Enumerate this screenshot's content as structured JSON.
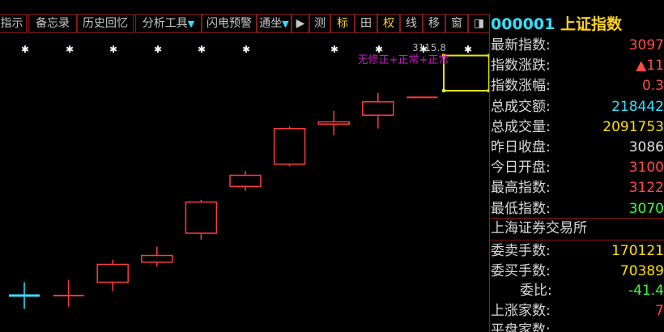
{
  "toolbar": {
    "items": [
      {
        "label": "指示"
      },
      {
        "label": "备忘录"
      },
      {
        "label": "历史回忆"
      },
      {
        "label": "分析工具",
        "arrow": "▼"
      },
      {
        "label": "闪电预警"
      },
      {
        "label": "通坐",
        "arrow": "▼"
      },
      {
        "label": "▶"
      },
      {
        "label": "测"
      },
      {
        "label": "标"
      },
      {
        "label": "田"
      },
      {
        "label": "权"
      },
      {
        "label": "线"
      },
      {
        "label": "移"
      },
      {
        "label": "窗"
      },
      {
        "label": "◨"
      }
    ]
  },
  "chart": {
    "price_label": "3115.8",
    "rights_mode": "无修正+正常+正常",
    "colors": {
      "up": "#ff3b3b",
      "doji": "#33e0ff",
      "box": "#e6e600",
      "marker": "#ffffff",
      "mode_text": "#c020c0"
    }
  },
  "chart_data": {
    "type": "candlestick",
    "series": [
      {
        "open": 3008,
        "close": 3008,
        "high": 3014,
        "low": 3002
      },
      {
        "open": 3008,
        "close": 3008,
        "high": 3015,
        "low": 3003
      },
      {
        "open": 3014,
        "close": 3022,
        "high": 3024,
        "low": 3010
      },
      {
        "open": 3023,
        "close": 3026,
        "high": 3030,
        "low": 3021
      },
      {
        "open": 3036,
        "close": 3050,
        "high": 3051,
        "low": 3033
      },
      {
        "open": 3057,
        "close": 3062,
        "high": 3064,
        "low": 3055
      },
      {
        "open": 3067,
        "close": 3083,
        "high": 3084,
        "low": 3066
      },
      {
        "open": 3085,
        "close": 3086,
        "high": 3091,
        "low": 3080
      },
      {
        "open": 3089,
        "close": 3095,
        "high": 3099,
        "low": 3083
      },
      {
        "open": 3097,
        "close": 3097,
        "high": 3097,
        "low": 3097
      },
      {
        "open": 3100,
        "close": 3115.8,
        "high": 3115.8,
        "low": 3096
      }
    ]
  },
  "panel": {
    "code": "000001",
    "name": "上证指数",
    "rows": [
      {
        "label": "最新指数:",
        "value": "3097",
        "color": "#ff4a4a"
      },
      {
        "label": "指数涨跌:",
        "value": "▲11",
        "color": "#ff4a4a"
      },
      {
        "label": "指数涨幅:",
        "value": "0.3",
        "color": "#ff4a4a"
      },
      {
        "label": "总成交额:",
        "value": "218442",
        "color": "#33e0ff"
      },
      {
        "label": "总成交量:",
        "value": "2091753",
        "color": "#ffe000"
      },
      {
        "label": "昨日收盘:",
        "value": "3086",
        "color": "#e0e0e0"
      },
      {
        "label": "今日开盘:",
        "value": "3100",
        "color": "#ff4a4a"
      },
      {
        "label": "最高指数:",
        "value": "3122",
        "color": "#ff4a4a"
      },
      {
        "label": "最低指数:",
        "value": "3070",
        "color": "#3cff3c"
      }
    ],
    "exchange": "上海证券交易所",
    "rows2": [
      {
        "label": "委卖手数:",
        "value": "170121",
        "color": "#ffe000",
        "ratio": false
      },
      {
        "label": "委买手数:",
        "value": "70389",
        "color": "#ffe000",
        "ratio": false
      },
      {
        "label": "委比:",
        "value": "-41.4",
        "color": "#3cff3c",
        "ratio": true
      },
      {
        "label": "上涨家数:",
        "value": "7",
        "color": "#ff4a4a",
        "ratio": false
      },
      {
        "label": "平盘家数:",
        "value": "",
        "color": "#e0e0e0",
        "ratio": false
      }
    ]
  }
}
